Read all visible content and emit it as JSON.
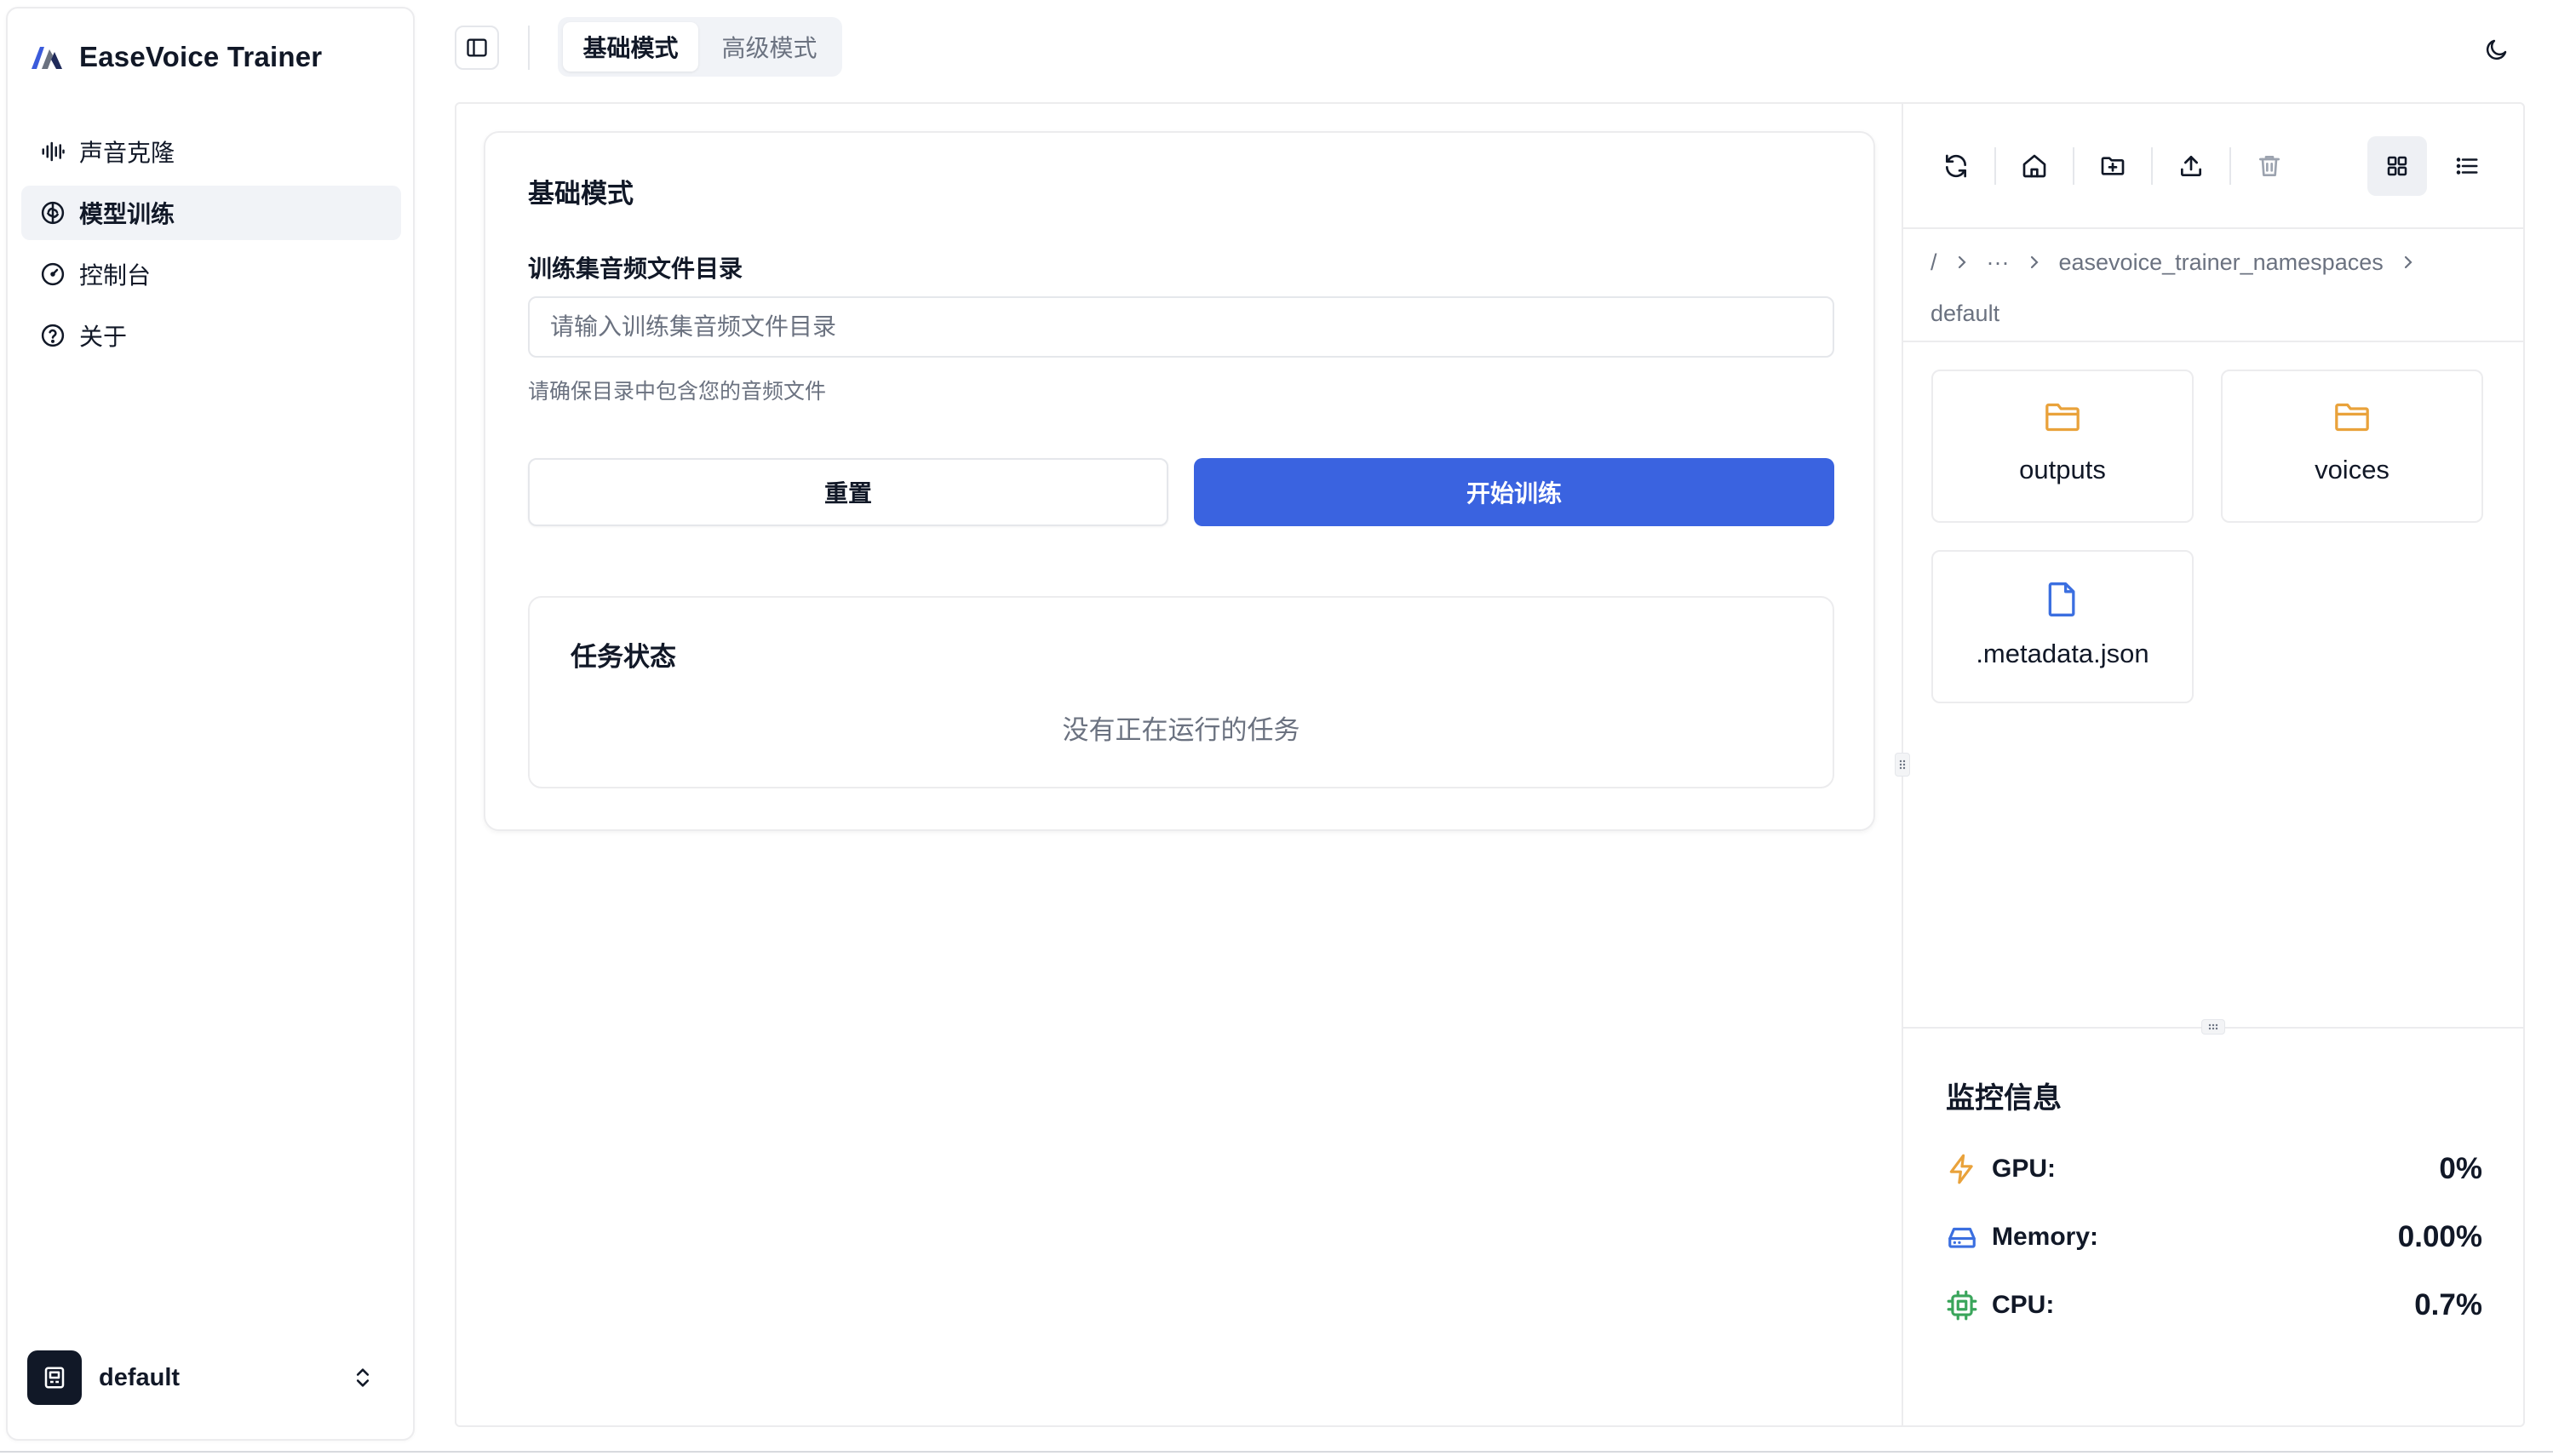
{
  "app": {
    "title": "EaseVoice Trainer"
  },
  "sidebar": {
    "items": [
      {
        "label": "声音克隆",
        "icon": "audio-waveform-icon"
      },
      {
        "label": "模型训练",
        "icon": "brain-icon",
        "active": true
      },
      {
        "label": "控制台",
        "icon": "gauge-icon"
      },
      {
        "label": "关于",
        "icon": "help-circle-icon"
      }
    ],
    "namespace": {
      "name": "default"
    }
  },
  "header": {
    "tabs": [
      {
        "label": "基础模式",
        "active": true
      },
      {
        "label": "高级模式",
        "active": false
      }
    ]
  },
  "form": {
    "title": "基础模式",
    "dir_label": "训练集音频文件目录",
    "dir_placeholder": "请输入训练集音频文件目录",
    "dir_value": "",
    "help": "请确保目录中包含您的音频文件",
    "reset_label": "重置",
    "start_label": "开始训练",
    "accent_color": "#3a63e0"
  },
  "task_status": {
    "title": "任务状态",
    "empty": "没有正在运行的任务"
  },
  "file_browser": {
    "breadcrumb": {
      "root": "/",
      "ellipsis": "···",
      "segment": "easevoice_trainer_namespaces",
      "current": "default"
    },
    "files": [
      {
        "name": "outputs",
        "type": "folder"
      },
      {
        "name": "voices",
        "type": "folder"
      },
      {
        "name": ".metadata.json",
        "type": "file"
      }
    ]
  },
  "monitor": {
    "title": "监控信息",
    "gpu": {
      "label": "GPU:",
      "value": "0%"
    },
    "memory": {
      "label": "Memory:",
      "value": "0.00%"
    },
    "cpu": {
      "label": "CPU:",
      "value": "0.7%"
    }
  }
}
